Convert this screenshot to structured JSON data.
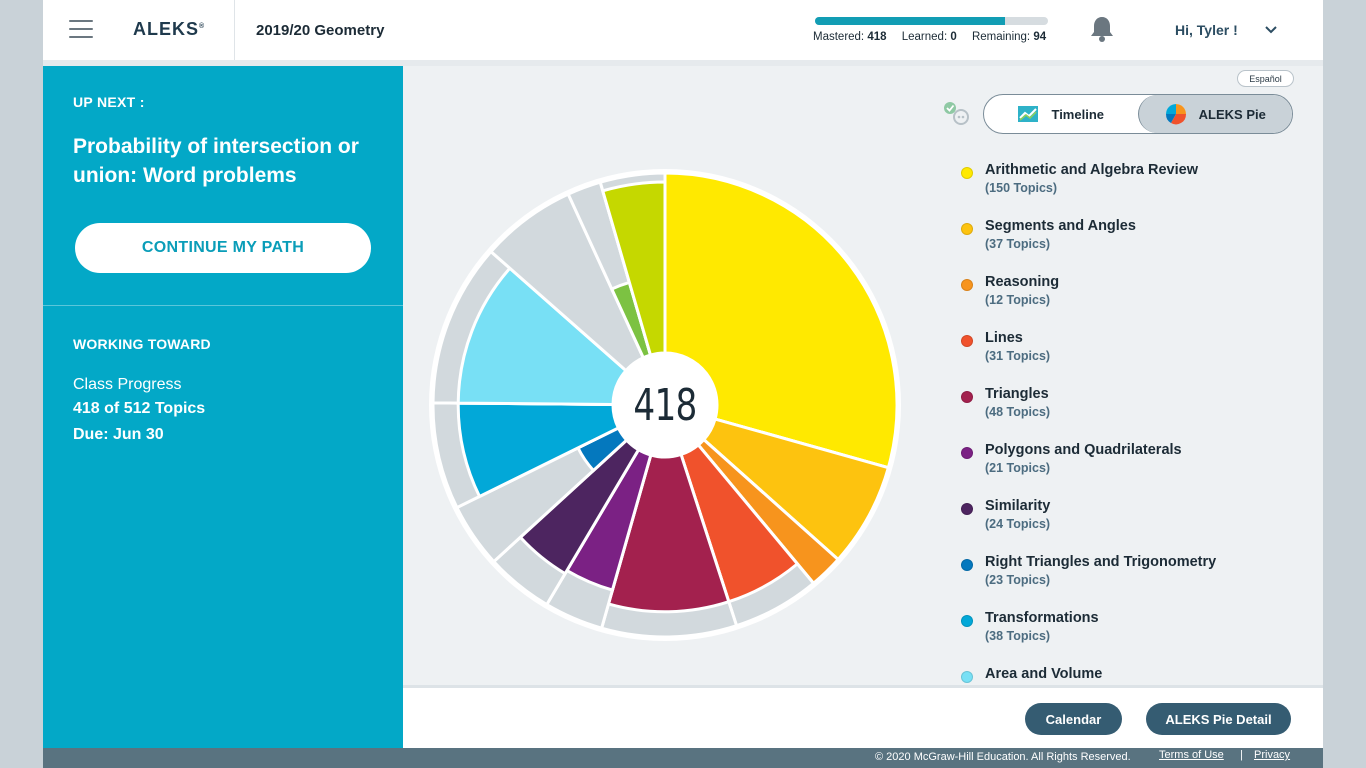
{
  "header": {
    "logo": "ALEKS",
    "logo_mark": "®",
    "course": "2019/20 Geometry",
    "progress": {
      "mastered_label": "Mastered:",
      "mastered": "418",
      "learned_label": "Learned:",
      "learned": "0",
      "remaining_label": "Remaining:",
      "remaining": "94",
      "mastered_fraction": 0.8164
    },
    "greeting": "Hi, Tyler !"
  },
  "left": {
    "up_next_label": "UP NEXT :",
    "up_next_title": "Probability of intersection or union: Word problems",
    "continue_label": "CONTINUE MY PATH",
    "working_toward_label": "WORKING TOWARD",
    "class_progress_label": "Class Progress",
    "class_progress_value": "418 of 512 Topics",
    "due": "Due: Jun 30"
  },
  "main": {
    "espanol": "Español",
    "toggle": {
      "timeline": "Timeline",
      "pie": "ALEKS Pie"
    },
    "center_number": "418",
    "legend": [
      {
        "name": "Arithmetic and Algebra Review",
        "count": "(150 Topics)",
        "color": "#ffe900"
      },
      {
        "name": "Segments and Angles",
        "count": "(37 Topics)",
        "color": "#fdc30f"
      },
      {
        "name": "Reasoning",
        "count": "(12 Topics)",
        "color": "#f7941d"
      },
      {
        "name": "Lines",
        "count": "(31 Topics)",
        "color": "#f0522c"
      },
      {
        "name": "Triangles",
        "count": "(48 Topics)",
        "color": "#a3214e"
      },
      {
        "name": "Polygons and Quadrilaterals",
        "count": "(21 Topics)",
        "color": "#7b2184"
      },
      {
        "name": "Similarity",
        "count": "(24 Topics)",
        "color": "#4d2560"
      },
      {
        "name": "Right Triangles and Trigonometry",
        "count": "(23 Topics)",
        "color": "#0478be"
      },
      {
        "name": "Transformations",
        "count": "(38 Topics)",
        "color": "#02a8d8"
      },
      {
        "name": "Area and Volume",
        "count": "",
        "color": "#78e0f5"
      }
    ]
  },
  "pie_data": {
    "slices": [
      {
        "topics": 150,
        "mastered_fraction": 1.0,
        "color": "#ffe900"
      },
      {
        "topics": 37,
        "mastered_fraction": 1.0,
        "color": "#fdc30f"
      },
      {
        "topics": 12,
        "mastered_fraction": 1.0,
        "color": "#f7941d"
      },
      {
        "topics": 31,
        "mastered_fraction": 0.86,
        "color": "#f0522c"
      },
      {
        "topics": 48,
        "mastered_fraction": 0.86,
        "color": "#a3214e"
      },
      {
        "topics": 21,
        "mastered_fraction": 0.78,
        "color": "#7b2184"
      },
      {
        "topics": 24,
        "mastered_fraction": 0.8,
        "color": "#4d2560"
      },
      {
        "topics": 23,
        "mastered_fraction": 0.25,
        "color": "#0478be"
      },
      {
        "topics": 38,
        "mastered_fraction": 0.86,
        "color": "#02a8d8"
      },
      {
        "topics": 58,
        "mastered_fraction": 0.86,
        "color": "#78e0f5"
      },
      {
        "topics": 34,
        "mastered_fraction": 0.0,
        "color": "#d2d9dd"
      },
      {
        "topics": 12,
        "mastered_fraction": 0.42,
        "color": "#7cc242"
      },
      {
        "topics": 23,
        "mastered_fraction": 0.95,
        "color": "#c5d800"
      }
    ],
    "unmastered_color": "#d2d9dd"
  },
  "footer": {
    "calendar": "Calendar",
    "pie_detail": "ALEKS Pie Detail",
    "copyright": "© 2020 McGraw-Hill Education. All Rights Reserved.",
    "terms": "Terms of Use",
    "separator": "|",
    "privacy": "Privacy"
  }
}
